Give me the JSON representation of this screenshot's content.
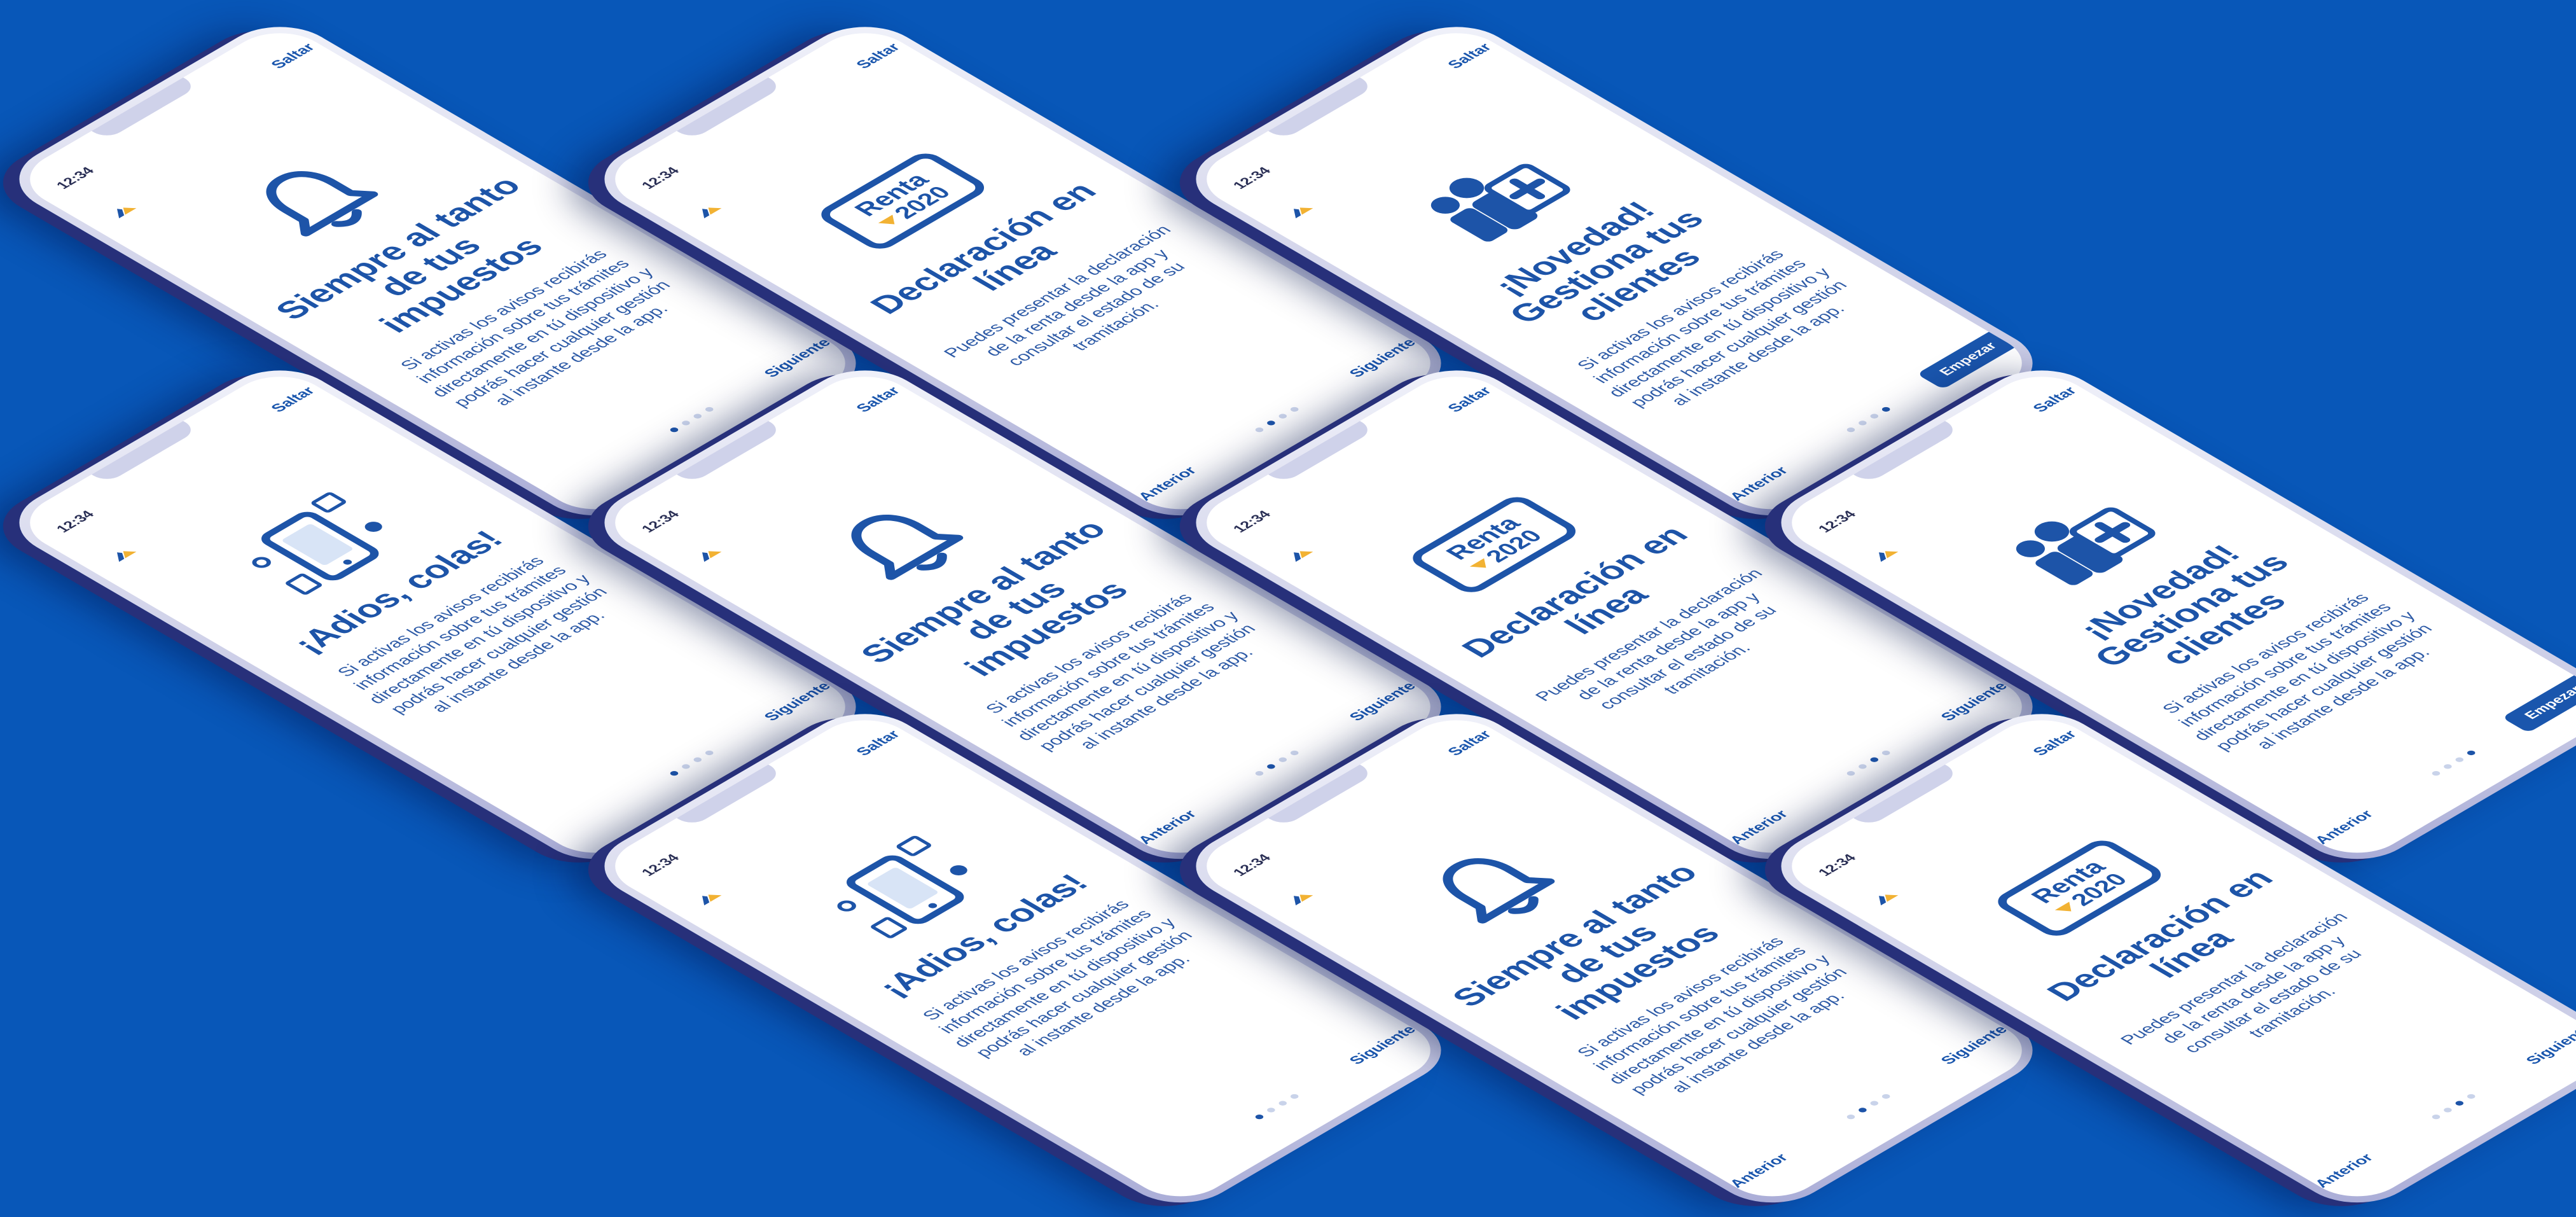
{
  "status": {
    "time": "12:34"
  },
  "labels": {
    "skip": "Saltar",
    "prev": "Anterior",
    "next": "Siguiente",
    "start": "Empezar"
  },
  "slides": {
    "bell": {
      "title": "Siempre al tanto de tus impuestos",
      "body": "Si activas los avisos recibirás información sobre tus trámites directamente en tú dispositivo y podrás hacer cualquier gestión al instante desde la app."
    },
    "colas": {
      "title": "¡Adios, colas!",
      "body": "Si activas los avisos recibirás información sobre tus trámites directamente en tú dispositivo y podrás hacer cualquier gestión al instante desde la app."
    },
    "renta": {
      "title": "Declaración en línea",
      "body": "Puedes presentar la declaración de la renta desde la app y consultar el estado de su tramitación.",
      "logo_word": "Renta",
      "logo_year": "2020"
    },
    "clientes": {
      "title": "¡Novedad! Gestiona tus clientes",
      "body": "Si activas los avisos recibirás información sobre tus trámites directamente en tú dispositivo y podrás hacer cualquier gestión al instante desde la app."
    }
  },
  "colors": {
    "background": "#0857b8",
    "brand": "#1d54a8",
    "screen": "#ffffff"
  }
}
